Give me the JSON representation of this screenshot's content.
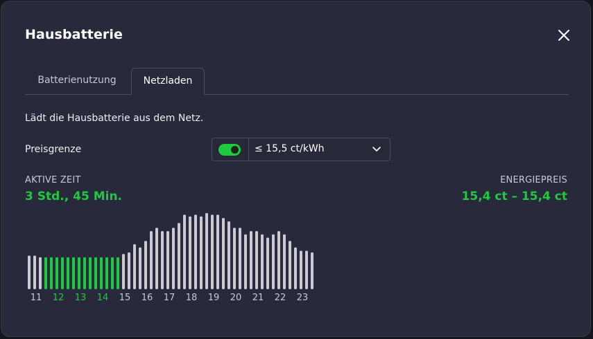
{
  "dialog": {
    "title": "Hausbatterie",
    "close_icon": "close-icon"
  },
  "tabs": [
    {
      "label": "Batterienutzung",
      "active": false
    },
    {
      "label": "Netzladen",
      "active": true
    }
  ],
  "description": "Lädt die Hausbatterie aus dem Netz.",
  "price_limit": {
    "label": "Preisgrenze",
    "enabled": true,
    "value": "≤ 15,5 ct/kWh",
    "chevron_icon": "chevron-down-icon"
  },
  "stats": {
    "active_time_label": "AKTIVE ZEIT",
    "active_time_value": "3 Std., 45 Min.",
    "energy_price_label": "ENERGIEPREIS",
    "energy_price_value": "15,4 ct – 15,4 ct"
  },
  "colors": {
    "accent": "#1ecb3f",
    "bar_inactive": "#c9cad4",
    "background": "#282a3b"
  },
  "chart_data": {
    "type": "bar",
    "x_tick_labels": [
      "11",
      "12",
      "13",
      "14",
      "15",
      "16",
      "17",
      "18",
      "19",
      "20",
      "21",
      "22",
      "23"
    ],
    "highlighted_tick_labels": [
      "12",
      "13",
      "14"
    ],
    "bars_per_hour": 4,
    "values": [
      15.5,
      15.5,
      15.4,
      15.4,
      15.4,
      15.4,
      15.4,
      15.4,
      15.4,
      15.4,
      15.4,
      15.4,
      15.4,
      15.4,
      15.4,
      15.4,
      15.4,
      15.6,
      15.7,
      16.2,
      16.0,
      16.4,
      17.0,
      17.2,
      17.0,
      17.0,
      17.2,
      17.5,
      18.0,
      17.9,
      18.0,
      17.9,
      18.1,
      18.0,
      18.0,
      17.8,
      17.6,
      17.2,
      17.2,
      16.8,
      17.0,
      17.0,
      16.8,
      16.6,
      16.8,
      17.0,
      16.8,
      16.4,
      16.0,
      15.8,
      15.8,
      15.7
    ],
    "active": [
      false,
      false,
      false,
      true,
      true,
      true,
      true,
      true,
      true,
      true,
      true,
      true,
      true,
      true,
      true,
      true,
      true,
      false,
      false,
      false,
      false,
      false,
      false,
      false,
      false,
      false,
      false,
      false,
      false,
      false,
      false,
      false,
      false,
      false,
      false,
      false,
      false,
      false,
      false,
      false,
      false,
      false,
      false,
      false,
      false,
      false,
      false,
      false,
      false,
      false,
      false,
      false
    ],
    "grid": false,
    "legend": "none"
  }
}
